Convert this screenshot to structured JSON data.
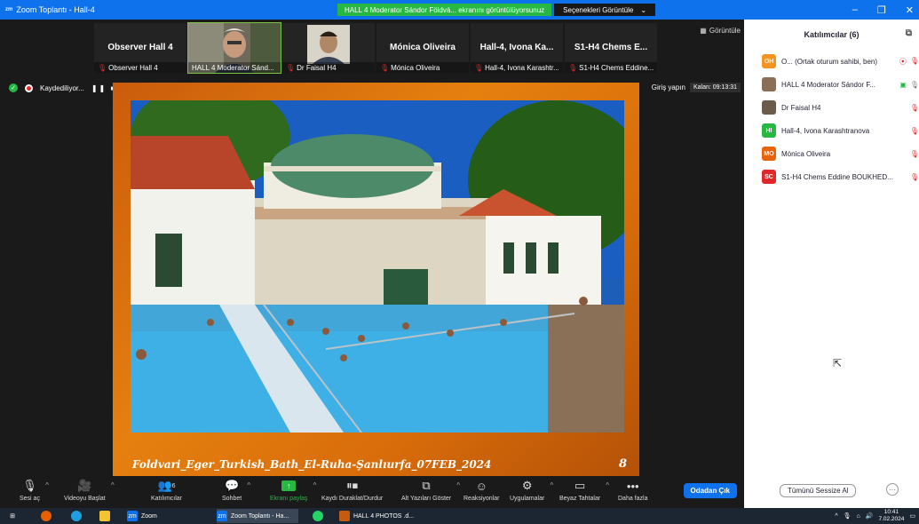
{
  "window": {
    "title": "Zoom Toplantı - Hall-4",
    "share_banner": "HALL 4 Moderator Sándor Földvá... ekranını görüntülüyorsunuz",
    "view_options": "Seçenekleri Görüntüle"
  },
  "thumbnails": [
    {
      "name": "Observer Hall 4",
      "label": "Observer Hall 4",
      "video": false
    },
    {
      "name": "",
      "label": "HALL 4 Moderator Sánd...",
      "video": true
    },
    {
      "name": "",
      "label": "Dr Faisal H4",
      "video": true
    },
    {
      "name": "Mónica Oliveira",
      "label": "Mónica Oliveira",
      "video": false
    },
    {
      "name": "Hall-4, Ivona Ka...",
      "label": "Hall-4, Ivona Karashtr...",
      "video": false
    },
    {
      "name": "S1-H4  Chems E...",
      "label": "S1-H4  Chems Eddine...",
      "video": false
    }
  ],
  "strip_view_button": "Görüntüle",
  "stage": {
    "recording_label": "Kaydediliyor...",
    "login_button": "Giriş yapın",
    "remaining": "Kalan: 09:13:31",
    "slide_caption": "Foldvari_Eger_Turkish_Bath_El-Ruha-Şanlıurfa_07FEB_2024",
    "slide_number": "8"
  },
  "toolbar": {
    "mute": "Sesi aç",
    "video": "Videoyu Başlat",
    "participants": "Katılımcılar",
    "participants_count": "6",
    "chat": "Sohbet",
    "share": "Ekranı paylaş",
    "record": "Kaydı Duraklat/Durdur",
    "captions": "Alt Yazıları Göster",
    "reactions": "Reaksiyonlar",
    "apps": "Uygulamalar",
    "whiteboards": "Beyaz Tahtalar",
    "more": "Daha fazla",
    "leave": "Odadan Çık"
  },
  "panel": {
    "title": "Katılımcılar (6)",
    "participants": [
      {
        "initials": "OH",
        "name": "O... (Ortak oturum sahibi, ben)",
        "color": "#f7931e"
      },
      {
        "initials": "",
        "name": "HALL 4 Moderator Sándor F...",
        "color": "#8a6e58"
      },
      {
        "initials": "",
        "name": "Dr Faisal H4",
        "color": "#6b5b4b"
      },
      {
        "initials": "HI",
        "name": "Hall-4, Ivona Karashtranova",
        "color": "#27b844"
      },
      {
        "initials": "MO",
        "name": "Mónica Oliveira",
        "color": "#e8630a"
      },
      {
        "initials": "SC",
        "name": "S1-H4  Chems Eddine BOUKHED...",
        "color": "#e02828"
      }
    ],
    "mute_all": "Tümünü Sessize Al"
  },
  "taskbar": {
    "zoom": "Zoom",
    "zoom_meeting": "Zoom Toplantı - Ha...",
    "photos": "HALL 4 PHOTOS .d...",
    "time": "10:41",
    "date": "7.02.2024"
  }
}
